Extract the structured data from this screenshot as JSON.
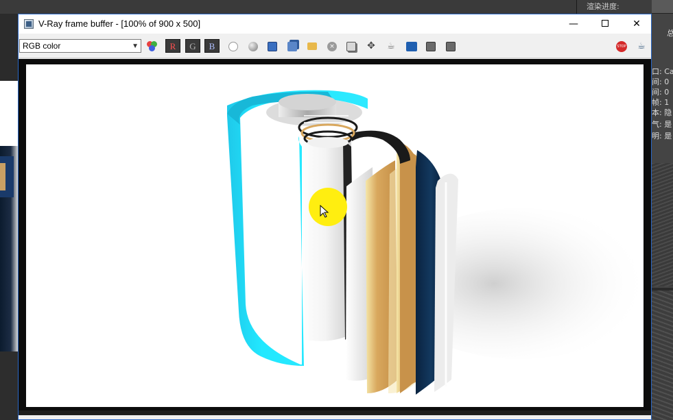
{
  "background": {
    "progress_label": "渲染进度:",
    "right_panel_labels": [
      "总",
      "口: Ca",
      "间: 0",
      "间: 0",
      "帧: 1",
      "本: 隐",
      "气: 是",
      "明: 是"
    ]
  },
  "window": {
    "title": "V-Ray frame buffer - [100% of 900 x 500]",
    "controls": {
      "minimize": "—",
      "maximize": "",
      "close": "✕"
    }
  },
  "toolbar": {
    "channel": "RGB color",
    "red_label": "R",
    "green_label": "G",
    "blue_label": "B"
  },
  "colors": {
    "cyan_shell": "#1fe3ff",
    "cursor_highlight": "#ffee10",
    "frame_border": "#2a68c7"
  },
  "icons": [
    "color-corrections-icon",
    "red-channel",
    "green-channel",
    "blue-channel",
    "view-alpha-icon",
    "mono-icon",
    "save-icon",
    "save-all-icon",
    "open-icon",
    "clear-icon",
    "duplicate-icon",
    "track-mouse-icon",
    "render-last-icon",
    "compare-ab-icon",
    "lut-icon",
    "pixel-info-icon",
    "stop-render-icon",
    "render-teapot-icon"
  ]
}
